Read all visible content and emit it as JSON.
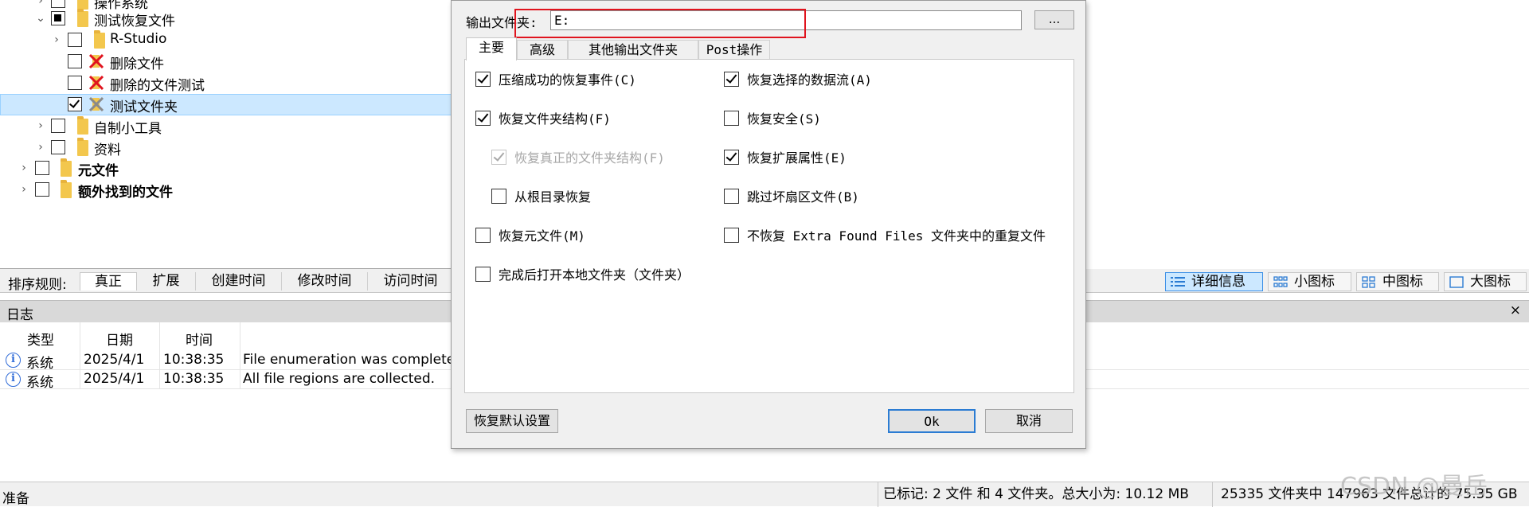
{
  "tree": {
    "items": [
      {
        "label": "操作系统",
        "bold": false
      },
      {
        "label": "测试恢复文件",
        "bold": false
      },
      {
        "label": "R-Studio",
        "bold": false
      },
      {
        "label": "删除文件",
        "bold": false
      },
      {
        "label": "删除的文件测试",
        "bold": false
      },
      {
        "label": "测试文件夹",
        "bold": false
      },
      {
        "label": "自制小工具",
        "bold": false
      },
      {
        "label": "资料",
        "bold": false
      },
      {
        "label": "元文件",
        "bold": true
      },
      {
        "label": "额外找到的文件",
        "bold": true
      }
    ]
  },
  "sortbar": {
    "label": "排序规则:",
    "tabs": [
      "真正",
      "扩展",
      "创建时间",
      "修改时间",
      "访问时间"
    ],
    "views": [
      "详细信息",
      "小图标",
      "中图标",
      "大图标"
    ]
  },
  "log": {
    "title": "日志",
    "close": "×",
    "columns": [
      "类型",
      "日期",
      "时间"
    ],
    "rows": [
      {
        "type": "系统",
        "date": "2025/4/1",
        "time": "10:38:35",
        "message": "File enumeration was complete"
      },
      {
        "type": "系统",
        "date": "2025/4/1",
        "time": "10:38:35",
        "message": "All file regions are collected."
      }
    ]
  },
  "status": {
    "ready": "准备",
    "marked": "已标记: 2 文件 和 4 文件夹。总大小为: 10.12 MB",
    "total": "25335 文件夹中 147963 文件总计的 75.35 GB"
  },
  "watermark": "CSDN @曼岳",
  "dialog": {
    "output_label": "输出文件夹:",
    "output_value": "E:",
    "browse_label": "...",
    "tabs": [
      "主要",
      "高级",
      "其他输出文件夹",
      "Post操作"
    ],
    "options": [
      {
        "label": "压缩成功的恢复事件(C)",
        "checked": true,
        "disabled": false
      },
      {
        "label": "恢复选择的数据流(A)",
        "checked": true,
        "disabled": false
      },
      {
        "label": "恢复文件夹结构(F)",
        "checked": true,
        "disabled": false
      },
      {
        "label": "恢复安全(S)",
        "checked": false,
        "disabled": false
      },
      {
        "label": "恢复真正的文件夹结构(F)",
        "checked": true,
        "disabled": true
      },
      {
        "label": "恢复扩展属性(E)",
        "checked": true,
        "disabled": false
      },
      {
        "label": "从根目录恢复",
        "checked": false,
        "disabled": false
      },
      {
        "label": "跳过坏扇区文件(B)",
        "checked": false,
        "disabled": false
      },
      {
        "label": "恢复元文件(M)",
        "checked": false,
        "disabled": false
      },
      {
        "label": "不恢复 Extra Found Files 文件夹中的重复文件",
        "checked": false,
        "disabled": false
      },
      {
        "label": "完成后打开本地文件夹（文件夹）",
        "checked": false,
        "disabled": false
      }
    ],
    "reset_label": "恢复默认设置",
    "ok_label": "Ok",
    "cancel_label": "取消"
  },
  "colors": {
    "selection": "#cce8ff",
    "accent": "#2b7cd3",
    "highlight_box": "#e0141e",
    "folder": "#f3c74d",
    "info_icon": "#2f6bd8"
  }
}
